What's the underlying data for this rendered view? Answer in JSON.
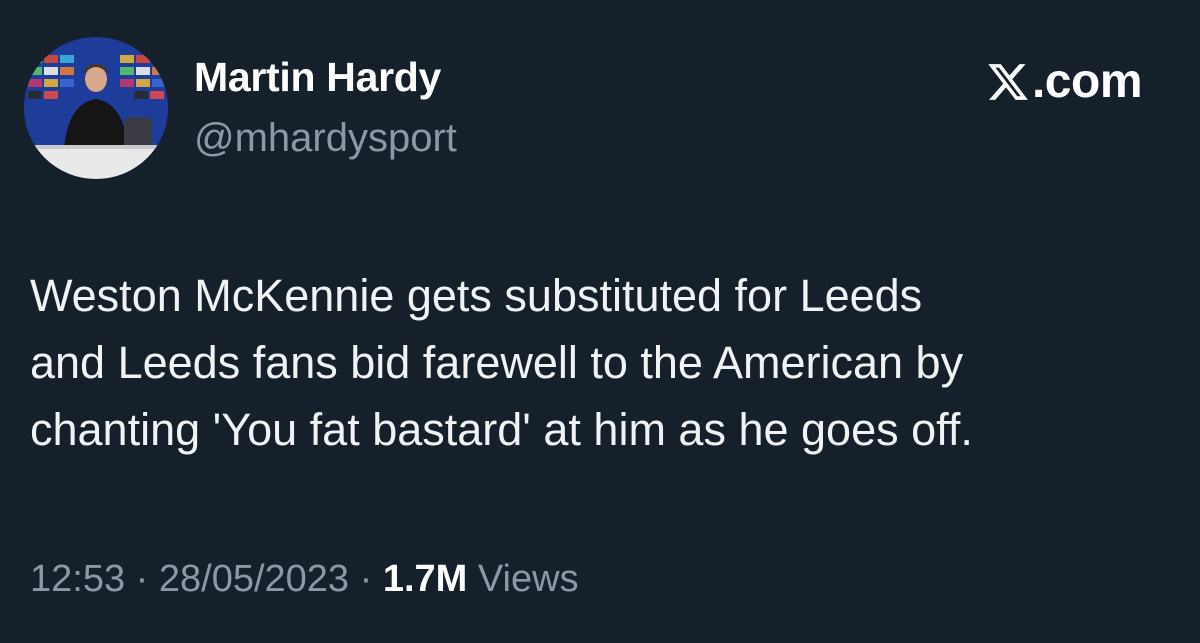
{
  "author": {
    "display_name": "Martin Hardy",
    "handle": "@mhardysport",
    "avatar_icon": "profile-photo"
  },
  "brand": {
    "logo_icon": "x-logo-icon",
    "text": ".com"
  },
  "tweet": {
    "lines": [
      "Weston McKennie gets substituted for Leeds",
      "and Leeds fans bid farewell to the American by",
      "chanting 'You fat bastard' at him as he goes off."
    ]
  },
  "meta": {
    "time": "12:53",
    "separator": "·",
    "date": "28/05/2023",
    "views_count": "1.7M",
    "views_label": "Views"
  },
  "colors": {
    "background": "#15202b",
    "text_primary": "#ffffff",
    "text_secondary": "#8b98a5"
  }
}
